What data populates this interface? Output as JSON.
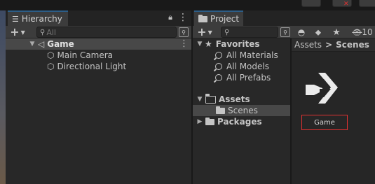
{
  "hierarchy": {
    "tab_label": "Hierarchy",
    "search_placeholder": "All",
    "scene_name": "Game",
    "children": [
      "Main Camera",
      "Directional Light"
    ]
  },
  "project": {
    "tab_label": "Project",
    "search_placeholder": "",
    "filter_count": "10",
    "tree": {
      "favorites_label": "Favorites",
      "favorites": [
        "All Materials",
        "All Models",
        "All Prefabs"
      ],
      "assets_label": "Assets",
      "assets_children": [
        "Scenes"
      ],
      "packages_label": "Packages"
    },
    "breadcrumb": {
      "root": "Assets",
      "separator": ">",
      "current": "Scenes"
    },
    "items": [
      {
        "name": "Game",
        "icon": "unity-scene-icon"
      }
    ]
  },
  "colors": {
    "accent_tab": "#2c5d87",
    "selection_outline": "#e03131"
  }
}
